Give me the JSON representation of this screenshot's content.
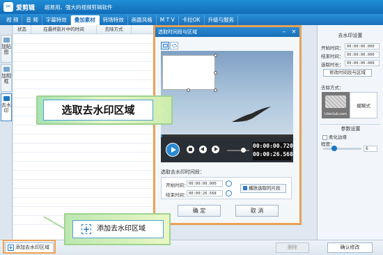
{
  "app": {
    "name": "爱剪辑",
    "slogan": "超易用、强大的视频剪辑软件"
  },
  "menu": [
    {
      "label": "视  频"
    },
    {
      "label": "音  频"
    },
    {
      "label": "字幕特效"
    },
    {
      "label": "叠加素材",
      "active": true
    },
    {
      "label": "转场特效"
    },
    {
      "label": "画面风格"
    },
    {
      "label": "M T V"
    },
    {
      "label": "卡拉OK"
    },
    {
      "label": "升级与服务"
    }
  ],
  "side_tabs": [
    {
      "label": "加贴图"
    },
    {
      "label": "加相框"
    },
    {
      "label": "去水印",
      "active": true
    }
  ],
  "list": {
    "columns": [
      "状态",
      "在最终影片中的时间",
      "去除方式"
    ]
  },
  "dialog": {
    "title": "选取时间段与区域",
    "timecode_current": "00:00:00.720",
    "timecode_total": "00:00:26.568",
    "section_label": "选取去水印时间段：",
    "start_label": "开始时间：",
    "start_value": "00:00:00.000",
    "end_label": "结束时间：",
    "end_value": "00:00:26.568",
    "play_selected_label": "播放选取的片段",
    "ok_label": "确  定",
    "cancel_label": "取  消"
  },
  "right_panel": {
    "header": "去水印设置",
    "start_label": "开始时间：",
    "start_value": "00:00:00.000",
    "end_label": "结束时间：",
    "end_value": "00:00:00.000",
    "duration_label": "选取时长：",
    "duration_value": "00:00:00.000",
    "modify_button": "修改时间段与区域",
    "method_label": "去除方式：",
    "preview_caption": "Liteclub.com",
    "method_value": "模糊式",
    "params_header": "参数设置",
    "soften_label": "柔化边缘",
    "degree_label": "程度：",
    "degree_value": "6"
  },
  "bottom": {
    "add_button": "添加去水印区域",
    "delete_button": "删除",
    "confirm_button": "确认修改"
  },
  "callouts": {
    "select_region": "选取去水印区域",
    "add_region": "添加去水印区域"
  }
}
